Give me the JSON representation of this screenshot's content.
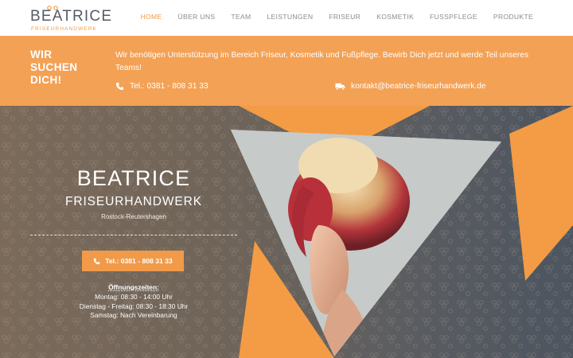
{
  "header": {
    "logo_main": "BEATRICE",
    "logo_sub": "FRISEURHANDWERK",
    "nav": [
      {
        "label": "HOME",
        "active": true
      },
      {
        "label": "ÜBER UNS"
      },
      {
        "label": "TEAM"
      },
      {
        "label": "LEISTUNGEN"
      },
      {
        "label": "FRISEUR"
      },
      {
        "label": "KOSMETIK"
      },
      {
        "label": "FUSSPFLEGE"
      },
      {
        "label": "PRODUKTE"
      }
    ]
  },
  "banner": {
    "title_line1": "WIR",
    "title_line2": "SUCHEN",
    "title_line3": "DICH!",
    "text": "Wir benötigen Unterstützung im Bereich Friseur, Kosmetik und Fußpflege. Bewirb Dich jetzt und werde Teil unseres Teams!",
    "phone": "Tel.: 0381 - 808 31 33",
    "email": "kontakt@beatrice-friseurhandwerk.de"
  },
  "hero": {
    "title": "BEATRICE",
    "subtitle": "FRISEURHANDWERK",
    "location": "Rostock-Reutershagen",
    "cta_label": "Tel.: 0381 - 808 31 33",
    "hours_title": "Öffnungszeiten:",
    "hours": [
      "Montag: 08:30 - 14:00 Uhr",
      "Dienstag - Freitag: 08:30 - 18:30 Uhr",
      "Samstag: Nach Vereinbarung"
    ]
  },
  "colors": {
    "accent": "#f19a4a",
    "banner_bg": "#f3a155",
    "nav_text": "#8c8c8c"
  }
}
